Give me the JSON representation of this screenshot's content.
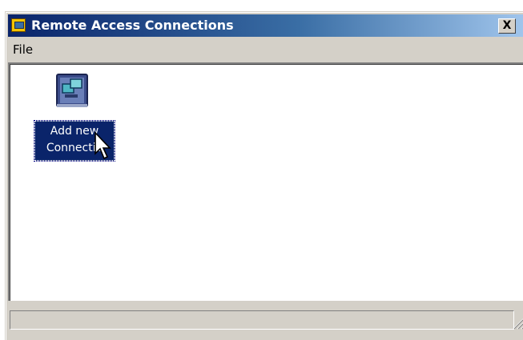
{
  "window": {
    "title": "Remote Access Connections",
    "close_label": "X"
  },
  "menu": {
    "items": [
      {
        "label": "File"
      }
    ]
  },
  "icons": [
    {
      "label_line1": "Add new",
      "label_line2": "Connectio",
      "icon": "add-connection-icon",
      "selected": true
    }
  ],
  "colors": {
    "titlebar_start": "#0a246a",
    "titlebar_end": "#a6caf0",
    "window_face": "#d4d0c8",
    "selection": "#0a246a"
  }
}
